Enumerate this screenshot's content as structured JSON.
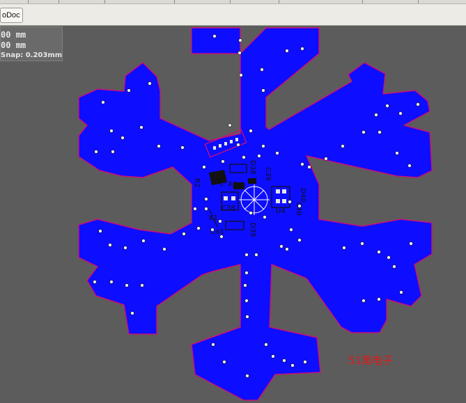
{
  "toolbar": {
    "document_tab_label": "oDoc"
  },
  "coordinates": {
    "x_text": "00 mm",
    "y_text": "00 mm",
    "snap_text": "Snap: 0.203mm"
  },
  "pcb": {
    "designators": [
      "C38",
      "C39",
      "D38",
      "U4",
      "C40",
      "R2",
      "K1",
      "D39",
      "C41",
      "R1",
      "D40"
    ],
    "watermark": "51黑电子"
  },
  "colors": {
    "workspace": "#5c5c5c",
    "board_fill": "#0d0dff",
    "board_outline": "#c8107a",
    "silkscreen": "#111111",
    "component_pad": "#e6e6e6",
    "watermark": "#e21818",
    "crosshair": "#ffffff"
  }
}
